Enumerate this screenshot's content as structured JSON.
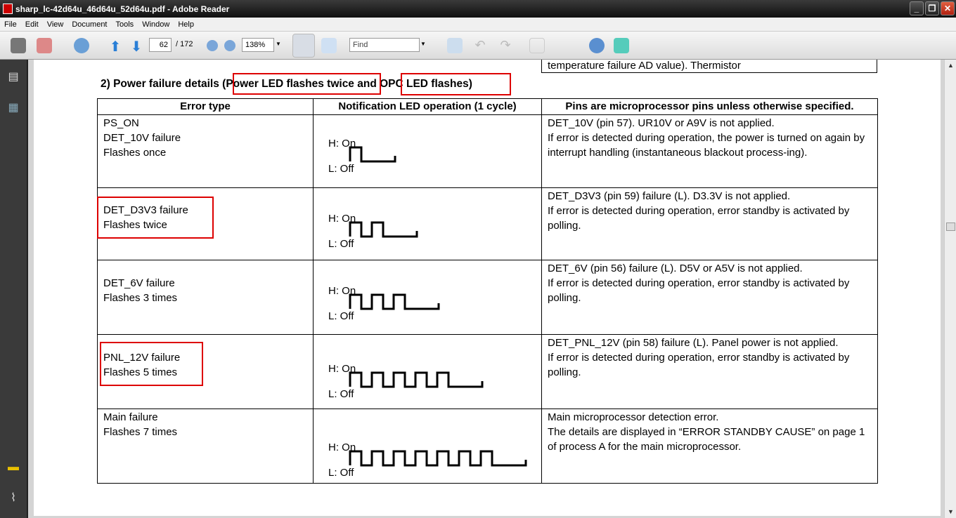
{
  "window": {
    "title": "sharp_lc-42d64u_46d64u_52d64u.pdf - Adobe Reader"
  },
  "menu": [
    "File",
    "Edit",
    "View",
    "Document",
    "Tools",
    "Window",
    "Help"
  ],
  "toolbar": {
    "page_current": "62",
    "page_total": "/ 172",
    "zoom": "138%",
    "find_placeholder": "Find"
  },
  "document": {
    "cut_text": "temperature failure AD value). Thermistor",
    "heading": {
      "prefix": "2) Power failure details (",
      "part1": "Power LED flashes twice",
      "mid": " and ",
      "part2": "OPC LED flashes)"
    },
    "headers": [
      "Error type",
      "Notification LED operation (1 cycle)",
      "Pins are microprocessor pins unless otherwise specified."
    ],
    "wave_labels": {
      "high": "H: On",
      "low": "L: Off"
    },
    "rows": [
      {
        "type": [
          "PS_ON",
          "DET_10V failure",
          "Flashes once"
        ],
        "flashes": 1,
        "desc": "DET_10V (pin 57). UR10V or A9V is not applied.\nIf error is detected during operation, the power is turned on again by interrupt handling (instantaneous blackout process-ing)."
      },
      {
        "type": [
          "DET_D3V3 failure",
          "Flashes twice"
        ],
        "flashes": 2,
        "desc": "DET_D3V3 (pin 59) failure (L). D3.3V is not applied.\nIf error is detected during operation, error standby is activated by polling."
      },
      {
        "type": [
          "DET_6V failure",
          "Flashes 3 times"
        ],
        "flashes": 3,
        "desc": "DET_6V (pin 56) failure (L). D5V or A5V is not applied.\nIf error is detected during operation, error standby is activated by polling."
      },
      {
        "type": [
          "PNL_12V failure",
          "Flashes 5 times"
        ],
        "flashes": 5,
        "desc": "DET_PNL_12V (pin 58) failure (L). Panel power is not applied.\nIf error is detected during operation, error standby is activated by polling."
      },
      {
        "type": [
          "Main failure",
          "Flashes 7 times"
        ],
        "flashes": 7,
        "desc": "Main microprocessor detection error.\nThe details are displayed in “ERROR STANDBY CAUSE” on page 1 of process A for the main microprocessor."
      }
    ]
  },
  "colors": {
    "highlight": "#dd0000"
  }
}
